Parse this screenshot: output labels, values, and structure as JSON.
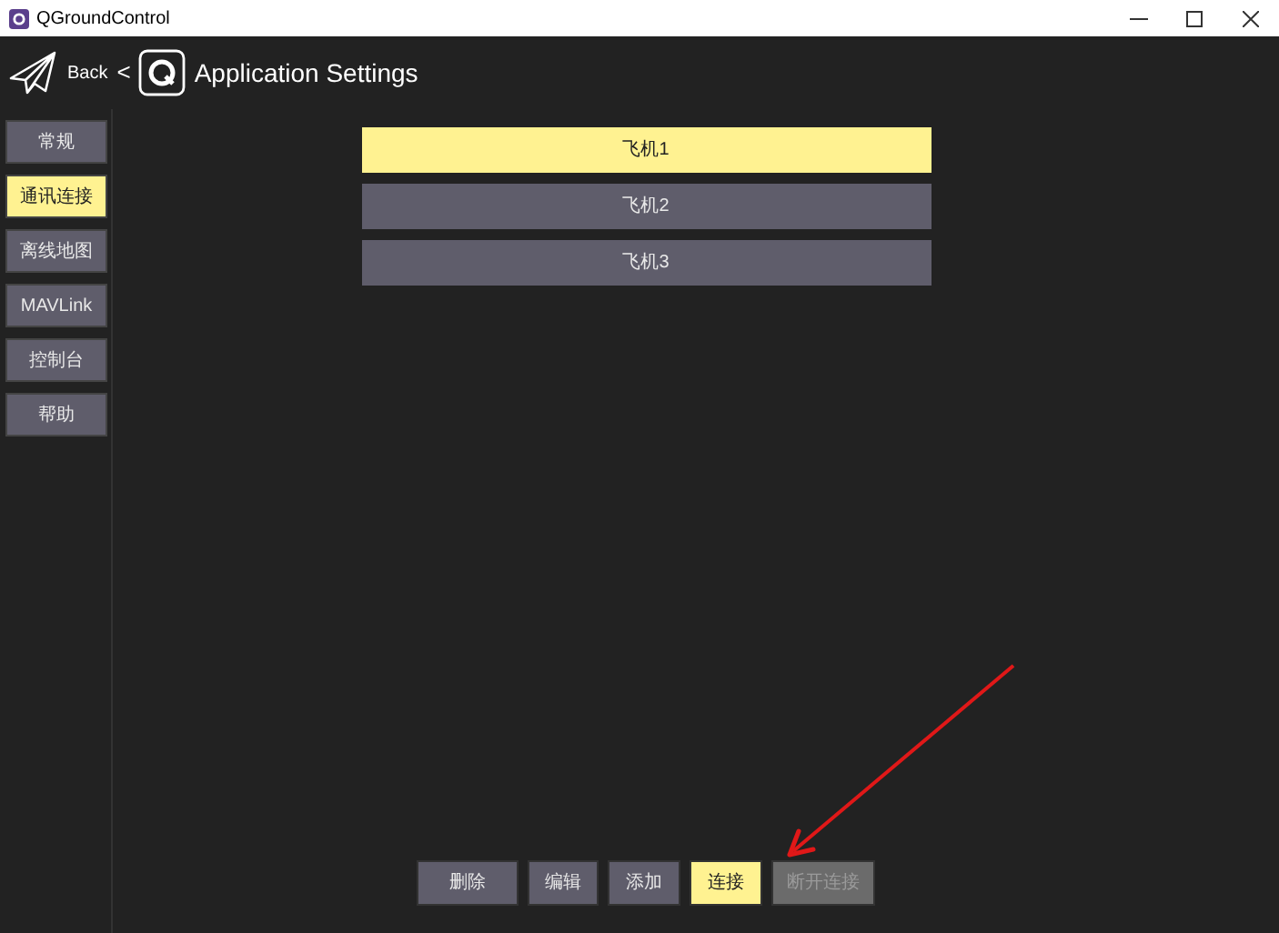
{
  "window": {
    "title": "QGroundControl"
  },
  "header": {
    "back": "Back",
    "separator": "<",
    "title": "Application Settings"
  },
  "sidebar": {
    "items": [
      {
        "label": "常规",
        "selected": false
      },
      {
        "label": "通讯连接",
        "selected": true
      },
      {
        "label": "离线地图",
        "selected": false
      },
      {
        "label": "MAVLink",
        "selected": false
      },
      {
        "label": "控制台",
        "selected": false
      },
      {
        "label": "帮助",
        "selected": false
      }
    ]
  },
  "links": [
    {
      "label": "飞机1",
      "selected": true
    },
    {
      "label": "飞机2",
      "selected": false
    },
    {
      "label": "飞机3",
      "selected": false
    }
  ],
  "actions": [
    {
      "label": "删除",
      "selected": false,
      "disabled": false
    },
    {
      "label": "编辑",
      "selected": false,
      "disabled": false
    },
    {
      "label": "添加",
      "selected": false,
      "disabled": false
    },
    {
      "label": "连接",
      "selected": true,
      "disabled": false
    },
    {
      "label": "断开连接",
      "selected": false,
      "disabled": true
    }
  ]
}
